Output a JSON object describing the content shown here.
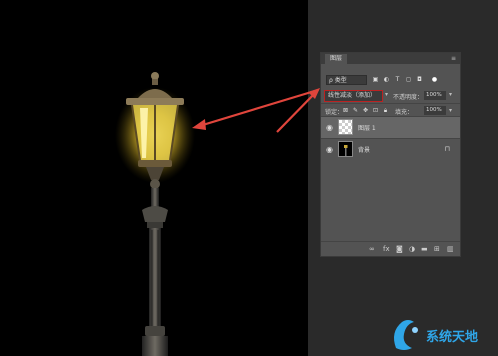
{
  "panel": {
    "tab_label": "图层",
    "menu_icon": "panel-menu-icon",
    "filter": {
      "kind_label": "ρ 类型",
      "icons": [
        "image-filter-icon",
        "adjustment-filter-icon",
        "type-filter-icon",
        "shape-filter-icon",
        "smart-object-filter-icon",
        "filter-toggle-icon"
      ]
    },
    "blend_mode": "线性减淡（添加）",
    "opacity_label": "不透明度：",
    "opacity_value": "100%",
    "lock_label": "锁定：",
    "fill_label": "填充：",
    "fill_value": "100%",
    "layers": [
      {
        "name": "图层 1",
        "selected": true,
        "visible": true
      },
      {
        "name": "背景",
        "selected": false,
        "visible": true,
        "locked": true
      }
    ],
    "footer_icons": [
      "link-layers-icon",
      "fx-icon",
      "mask-icon",
      "adjustment-layer-icon",
      "group-folder-icon",
      "new-layer-icon",
      "trash-icon"
    ]
  },
  "colors": {
    "arrow": "#e0453c",
    "highlight_border": "#bb2222",
    "panel_bg": "#535353",
    "watermark": "#2fa6e8"
  },
  "watermark": {
    "text": "系统天地"
  }
}
